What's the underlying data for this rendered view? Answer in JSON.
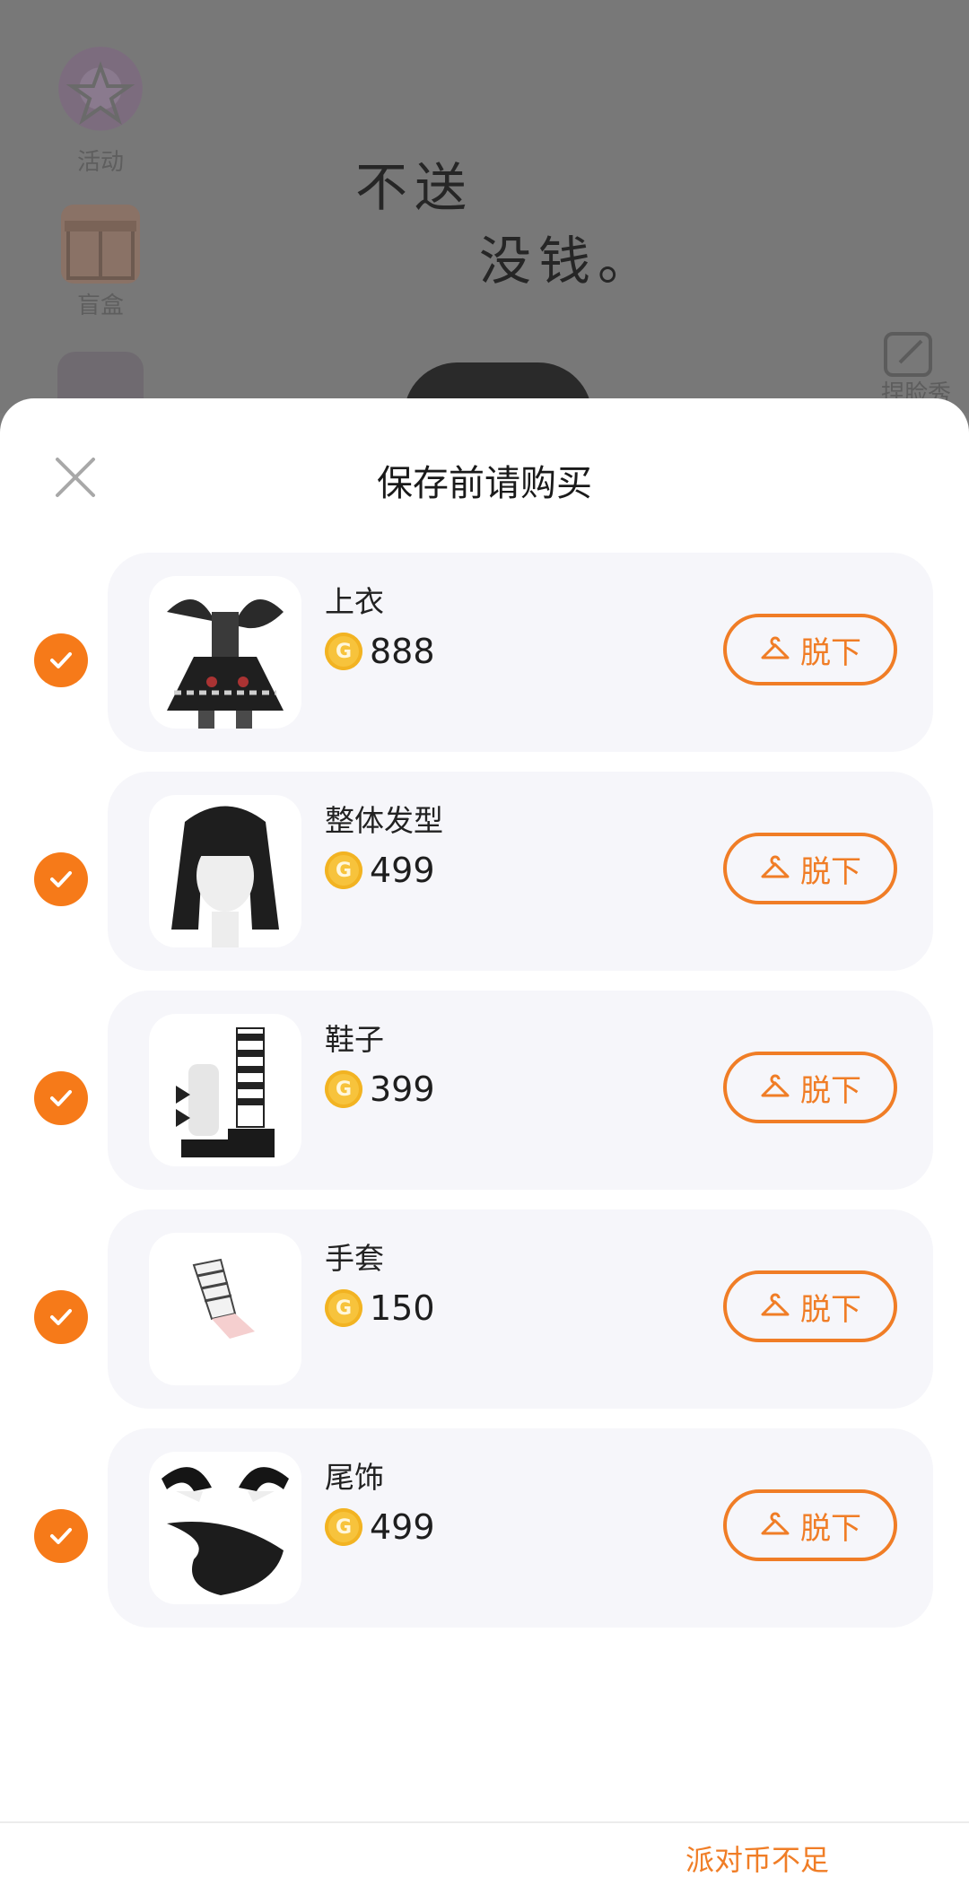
{
  "background": {
    "side_items": [
      {
        "label": "活动",
        "icon": "star-badge-icon"
      },
      {
        "label": "盲盒",
        "icon": "gift-box-icon"
      },
      {
        "label": "",
        "icon": "character-avatar-icon"
      }
    ],
    "doodle_line1": "不送",
    "doodle_line2": "没钱。",
    "right_label": "捏脸秀"
  },
  "sheet": {
    "title": "保存前请购买",
    "close_icon": "close-icon",
    "items": [
      {
        "name": "上衣",
        "price": "888",
        "button": "脱下",
        "checked": true
      },
      {
        "name": "整体发型",
        "price": "499",
        "button": "脱下",
        "checked": true
      },
      {
        "name": "鞋子",
        "price": "399",
        "button": "脱下",
        "checked": true
      },
      {
        "name": "手套",
        "price": "150",
        "button": "脱下",
        "checked": true
      },
      {
        "name": "尾饰",
        "price": "499",
        "button": "脱下",
        "checked": true
      }
    ],
    "footer_note": "派对币不足"
  },
  "colors": {
    "accent": "#f07d26",
    "check": "#f67a19",
    "coin": "#f7c33c",
    "row_bg": "#f6f6fa"
  }
}
